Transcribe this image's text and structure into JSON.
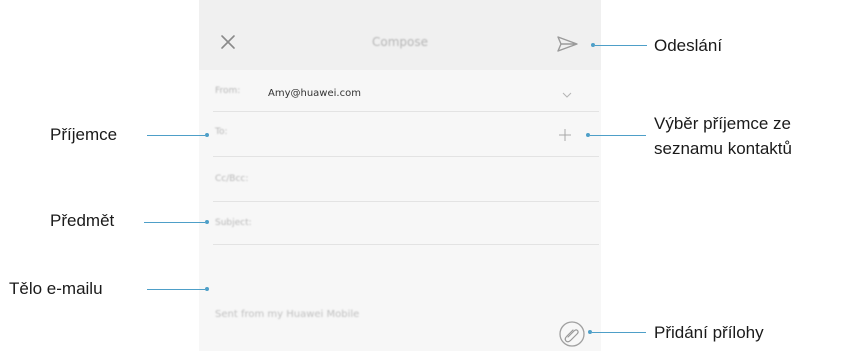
{
  "screen": {
    "title": "Compose",
    "from_label": "From:",
    "from_value": "Amy@huawei.com",
    "to_label": "To:",
    "cc_label": "Cc/Bcc:",
    "subject_label": "Subject:",
    "signature": "Sent from my Huawei Mobile"
  },
  "callouts": {
    "send": "Odeslání",
    "recipient": "Příjemce",
    "pick_line1": "Výběr příjemce ze",
    "pick_line2": "seznamu kontaktů",
    "subject": "Předmět",
    "body": "Tělo e-mailu",
    "attach": "Přidání přílohy"
  },
  "colors": {
    "accent_line": "#4e9fc8",
    "toolbar_bg": "#f0f0f0",
    "screen_bg": "#f7f7f7"
  },
  "icons": {
    "close": "close-icon",
    "send": "send-icon",
    "from_expand": "chevron-down-icon",
    "add_contact": "plus-icon",
    "attach": "paperclip-icon"
  }
}
